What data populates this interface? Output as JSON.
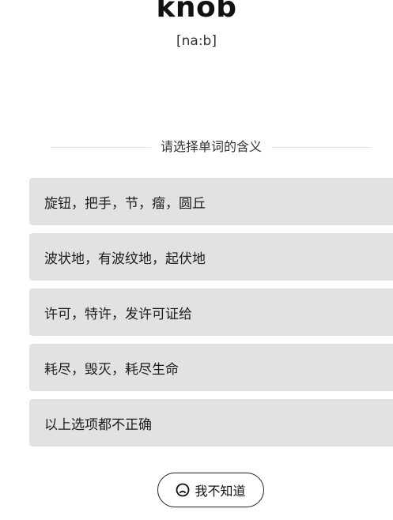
{
  "word": {
    "text": "knob",
    "phonetic": "[na:b]"
  },
  "quiz": {
    "prompt": "请选择单词的含义",
    "options": [
      "旋钮，把手，节，瘤，圆丘",
      "波状地，有波纹地，起伏地",
      "许可，特许，发许可证给",
      "耗尽，毁灭，耗尽生命",
      "以上选项都不正确"
    ],
    "dont_know_label": "我不知道",
    "dont_know_icon": "sad-face-icon"
  },
  "colors": {
    "option_background": "#e2e2e2",
    "text": "#1a1a1a",
    "divider": "#e2e2e2"
  }
}
